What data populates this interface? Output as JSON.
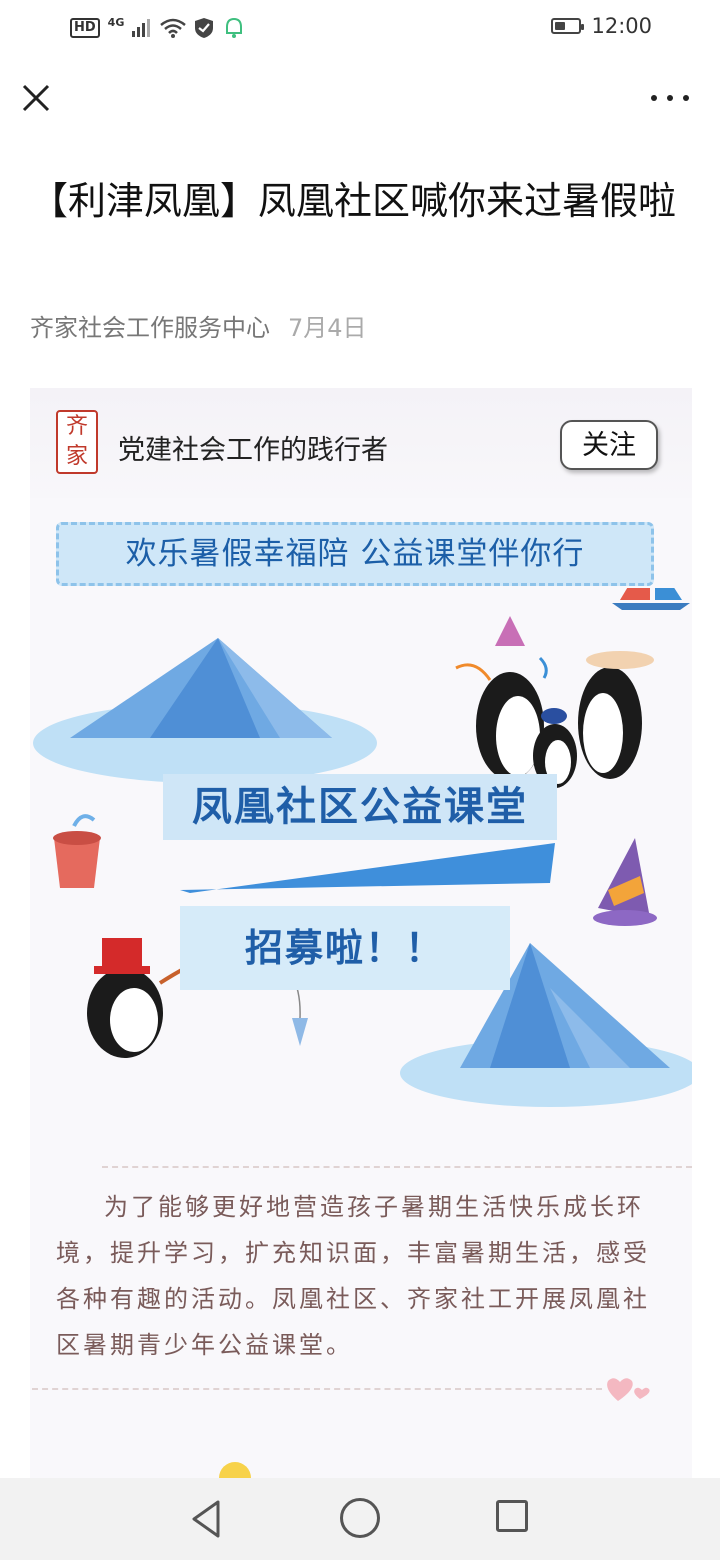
{
  "status_bar": {
    "network_label": "HD",
    "signal_type": "4G",
    "battery_level": 0.45,
    "time": "12:00",
    "icons": [
      "signal-icon",
      "wifi-icon",
      "shield-icon",
      "notification-icon",
      "battery-icon"
    ]
  },
  "nav": {
    "close_icon": "close-icon",
    "more_icon": "more-icon"
  },
  "article": {
    "title": "【利津凤凰】凤凰社区喊你来过暑假啦",
    "author": "齐家社会工作服务中心",
    "date": "7月4日"
  },
  "poster": {
    "logo_text_top": "齐",
    "logo_text_bottom": "家",
    "account_name": "党建社会工作的践行者",
    "follow_label": "关注",
    "banner": "欢乐暑假幸福陪  公益课堂伴你行",
    "headline": "凤凰社区公益课堂",
    "recruit": "招募啦！！",
    "paragraph": "为了能够更好地营造孩子暑期生活快乐成长环境，提升学习，扩充知识面，丰富暑期生活，感受各种有趣的活动。凤凰社区、齐家社工开展凤凰社区暑期青少年公益课堂。",
    "colors": {
      "banner_bg": "#cfe7f8",
      "headline_text": "#1f5ea8",
      "paragraph_text": "#7a5b5a"
    }
  },
  "android_nav": {
    "back_icon": "back-icon",
    "home_icon": "home-icon",
    "recent_icon": "recent-apps-icon"
  }
}
